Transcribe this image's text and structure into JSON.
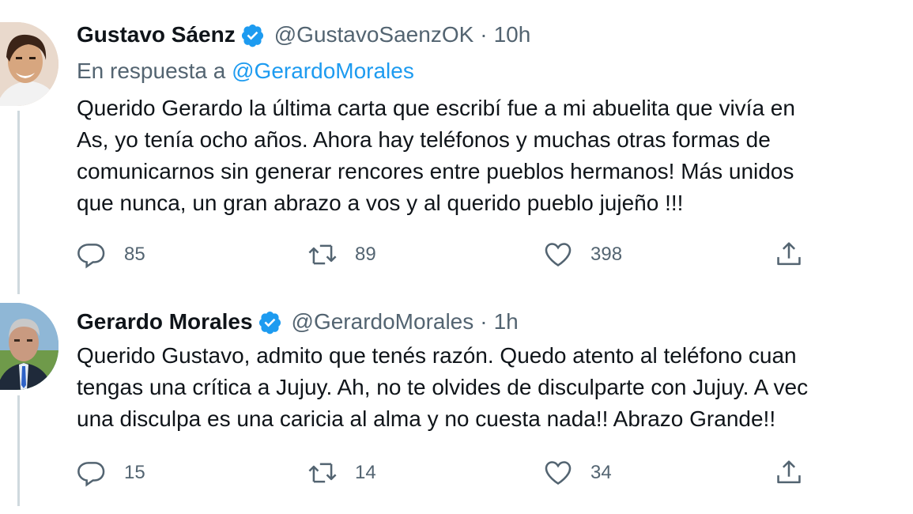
{
  "tweets": [
    {
      "name": "Gustavo Sáenz",
      "handle": "@GustavoSaenzOK",
      "separator": "·",
      "time": "10h",
      "reply_prefix": "En respuesta a ",
      "reply_to": "@GerardoMorales",
      "lines": [
        "Querido Gerardo la última carta que escribí fue a mi abuelita que vivía en",
        "As, yo tenía ocho años. Ahora hay teléfonos y muchas otras formas de",
        "comunicarnos sin generar rencores entre pueblos hermanos! Más unidos",
        "que nunca, un gran abrazo a vos y al querido pueblo jujeño !!!"
      ],
      "replies": "85",
      "retweets": "89",
      "likes": "398"
    },
    {
      "name": "Gerardo Morales",
      "handle": "@GerardoMorales",
      "separator": "·",
      "time": "1h",
      "lines": [
        "Querido Gustavo, admito que tenés razón. Quedo atento al teléfono cuan",
        "tengas una crítica a Jujuy. Ah, no te olvides de disculparte con Jujuy. A vec",
        "una disculpa es una caricia al alma y no cuesta nada!! Abrazo Grande!!"
      ],
      "replies": "15",
      "retweets": "14",
      "likes": "34"
    }
  ],
  "icons": {
    "verified": "verified-badge-icon",
    "reply": "reply-icon",
    "retweet": "retweet-icon",
    "like": "heart-icon",
    "share": "share-icon"
  },
  "colors": {
    "text": "#0f1419",
    "secondary": "#536471",
    "accent": "#1d9bf0",
    "thread_line": "#cfd9de"
  }
}
